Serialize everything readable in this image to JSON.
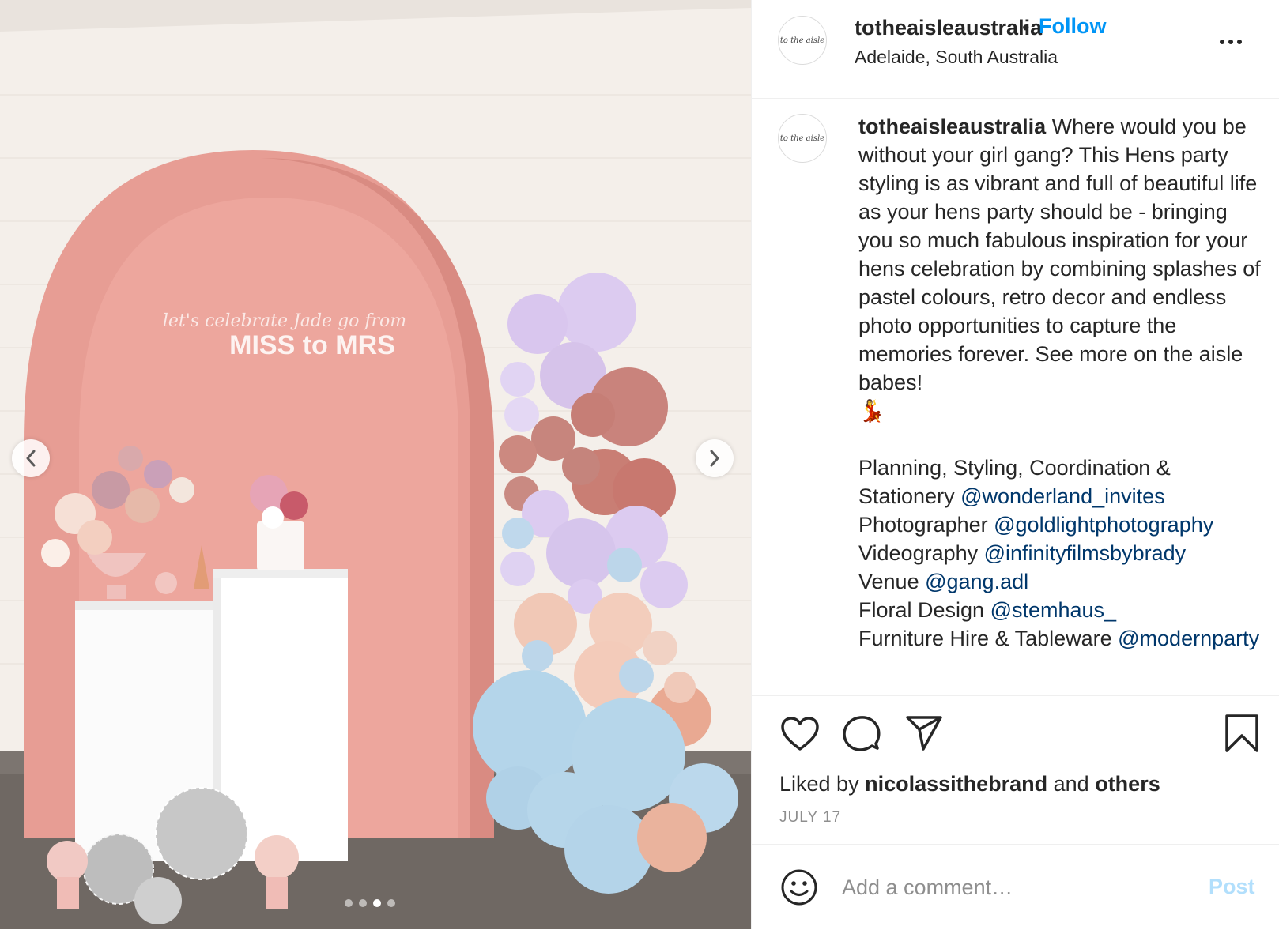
{
  "post": {
    "username": "totheaisleaustralia",
    "follow_label": "Follow",
    "separator": "•",
    "location": "Adelaide, South Australia",
    "avatar_text": "to the aisle"
  },
  "photo": {
    "sign_script": "let's celebrate Jade go from",
    "sign_main": "MISS to MRS",
    "slide_count": 4,
    "active_slide": 3
  },
  "caption": {
    "username": "totheaisleaustralia",
    "text": " Where would you be without your girl gang? This Hens party styling is as vibrant and full of beautiful life as your hens party should be - bringing you so much fabulous inspiration for your hens celebration by combining splashes of pastel colours, retro decor and endless photo opportunities to capture the memories forever. See more on the aisle babes!",
    "emoji": "💃",
    "credits": [
      {
        "label": "Planning, Styling, Coordination & Stationery ",
        "handle": "@wonderland_invites"
      },
      {
        "label": "Photographer ",
        "handle": "@goldlightphotography"
      },
      {
        "label": "Videography ",
        "handle": "@infinityfilmsbybrady"
      },
      {
        "label": "Venue ",
        "handle": "@gang.adl"
      },
      {
        "label": "Floral Design ",
        "handle": "@stemhaus_"
      },
      {
        "label": "Furniture Hire & Tableware ",
        "handle": "@modernparty"
      }
    ]
  },
  "likes": {
    "prefix": "Liked by ",
    "user": "nicolassithebrand",
    "middle": " and ",
    "others": "others"
  },
  "date": "JULY 17",
  "comment": {
    "placeholder": "Add a comment…",
    "post_label": "Post"
  },
  "colors": {
    "link": "#00376b",
    "follow": "#0095f6",
    "post_disabled": "#b2dffc",
    "arch": "#eaa39b"
  }
}
